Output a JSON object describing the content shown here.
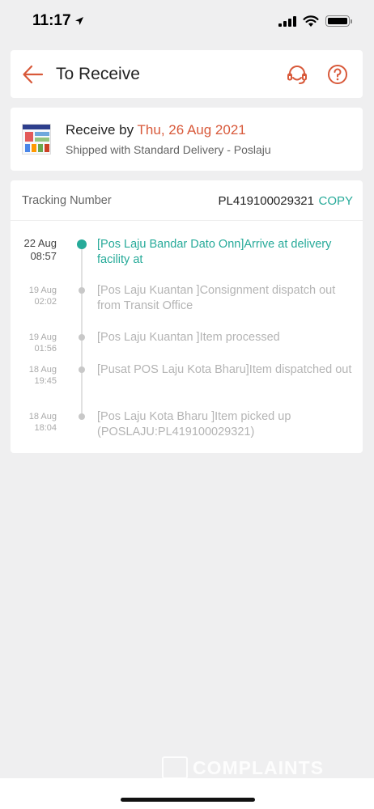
{
  "status_bar": {
    "time": "11:17"
  },
  "header": {
    "title": "To Receive"
  },
  "delivery": {
    "receive_prefix": "Receive by",
    "receive_date": "Thu, 26 Aug 2021",
    "shipped": "Shipped with Standard Delivery  - Poslaju"
  },
  "tracking": {
    "label": "Tracking Number",
    "number": "PL419100029321",
    "copy_label": "COPY",
    "events": [
      {
        "date": "22 Aug",
        "time": "08:57",
        "text": "[Pos Laju Bandar Dato Onn]Arrive at delivery facility at"
      },
      {
        "date": "19 Aug",
        "time": "02:02",
        "text": "[Pos Laju Kuantan ]Consignment dispatch out from Transit Office"
      },
      {
        "date": "19 Aug",
        "time": "01:56",
        "text": "[Pos Laju Kuantan ]Item processed"
      },
      {
        "date": "18 Aug",
        "time": "19:45",
        "text": "[Pusat POS Laju Kota Bharu]Item dispatched out"
      },
      {
        "date": "18 Aug",
        "time": "18:04",
        "text": "[Pos Laju Kota Bharu ]Item picked up (POSLAJU:PL419100029321)"
      }
    ]
  },
  "watermark": {
    "text": "COMPLAINTS"
  },
  "colors": {
    "accent_orange": "#d8593a",
    "accent_teal": "#26aa99"
  },
  "icons": [
    "location-arrow-icon",
    "signal-icon",
    "wifi-icon",
    "battery-icon",
    "back-arrow-icon",
    "headset-icon",
    "help-icon",
    "product-thumbnail"
  ]
}
